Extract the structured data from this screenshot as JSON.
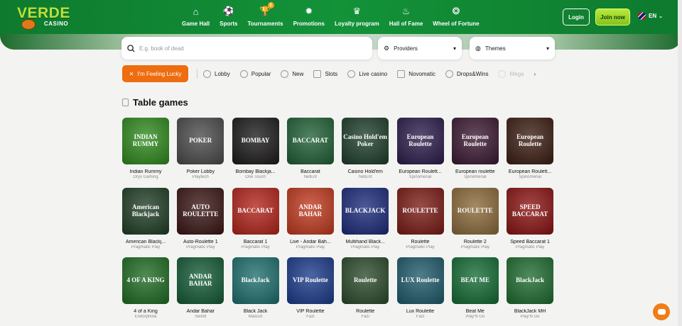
{
  "logo": {
    "big": "VERDE",
    "small": "CASINO"
  },
  "nav": [
    {
      "label": "Game Hall",
      "icon": "home-icon"
    },
    {
      "label": "Sports",
      "icon": "ball-icon"
    },
    {
      "label": "Tournaments",
      "icon": "trophy-icon",
      "badge": "2"
    },
    {
      "label": "Promotions",
      "icon": "gift-icon"
    },
    {
      "label": "Loyalty program",
      "icon": "crown-icon"
    },
    {
      "label": "Hall of Fame",
      "icon": "flame-icon"
    },
    {
      "label": "Wheel of Fortune",
      "icon": "wheel-icon"
    }
  ],
  "header": {
    "login": "Login",
    "join": "Join now",
    "lang": "EN"
  },
  "search": {
    "placeholder": "E.g. book of dead",
    "providers": "Providers",
    "themes": "Themes"
  },
  "filters": {
    "lucky": "I'm Feeling Lucky",
    "chips": [
      "Lobby",
      "Popular",
      "New",
      "Slots",
      "Live casino",
      "Novomatic",
      "Drops&Wins",
      "Mega"
    ]
  },
  "section": {
    "title": "Table games"
  },
  "colors": {
    "brand": "#139238",
    "accent": "#ed6d10",
    "join": "#9ad62a"
  },
  "games": [
    {
      "name": "Indian Rummy",
      "provider": "Oryx Gaming",
      "bg": "#2f8a1d",
      "art": "INDIAN RUMMY"
    },
    {
      "name": "Poker Lobby",
      "provider": "Playtech",
      "bg": "#4a4a4a",
      "art": "POKER"
    },
    {
      "name": "Bombay Blackja...",
      "provider": "One Touch",
      "bg": "#1c1a1a",
      "art": "BOMBAY"
    },
    {
      "name": "Baccarat",
      "provider": "NetEnt",
      "bg": "#1f5f34",
      "art": "BACCARAT"
    },
    {
      "name": "Casino Hold'em",
      "provider": "NetEnt",
      "bg": "#1c3d2a",
      "art": "Casino Hold'em Poker"
    },
    {
      "name": "European Roulett...",
      "provider": "Spinomenal",
      "bg": "#2b1b4a",
      "art": "European Roulette"
    },
    {
      "name": "European roulette",
      "provider": "Spinomenal",
      "bg": "#3a1830",
      "art": "European Roulette"
    },
    {
      "name": "European Roulett...",
      "provider": "Spinomenal",
      "bg": "#3b1c12",
      "art": "European Roulette"
    },
    {
      "name": "American Blackj...",
      "provider": "Pragmatic Play",
      "bg": "#1f3d25",
      "art": "American Blackjack"
    },
    {
      "name": "Auto-Roulette 1",
      "provider": "Pragmatic Play",
      "bg": "#3a1414",
      "art": "AUTO ROULETTE"
    },
    {
      "name": "Baccarat 1",
      "provider": "Pragmatic Play",
      "bg": "#b2231a",
      "art": "BACCARAT"
    },
    {
      "name": "Live - Andar Bah...",
      "provider": "Pragmatic Play",
      "bg": "#c0391e",
      "art": "ANDAR BAHAR"
    },
    {
      "name": "Multihand Black...",
      "provider": "Pragmatic Play",
      "bg": "#1b2a7a",
      "art": "BLACKJACK"
    },
    {
      "name": "Roulette",
      "provider": "Pragmatic Play",
      "bg": "#7a1a14",
      "art": "ROULETTE"
    },
    {
      "name": "Roulette 2",
      "provider": "Pragmatic Play",
      "bg": "#8b6a3a",
      "art": "ROULETTE"
    },
    {
      "name": "Speed Baccarat 1",
      "provider": "Pragmatic Play",
      "bg": "#8a1212",
      "art": "SPEED BACCARAT"
    },
    {
      "name": "4 of a King",
      "provider": "Endorphina",
      "bg": "#1f6b23",
      "art": "4 OF A KING"
    },
    {
      "name": "Andar Bahar",
      "provider": "Swintt",
      "bg": "#125a35",
      "art": "ANDAR BAHAR"
    },
    {
      "name": "Black Jack",
      "provider": "Mascot",
      "bg": "#1e6e6e",
      "art": "BlackJack"
    },
    {
      "name": "VIP Roulette",
      "provider": "Fazi",
      "bg": "#1a3a8a",
      "art": "VIP Roulette"
    },
    {
      "name": "Roulette",
      "provider": "Fazi",
      "bg": "#2a4a2a",
      "art": "Roulette"
    },
    {
      "name": "Lux Roulette",
      "provider": "Fazi",
      "bg": "#1d5a6a",
      "art": "LUX Roulette"
    },
    {
      "name": "Beat Me",
      "provider": "Play'N Go",
      "bg": "#146b33",
      "art": "BEAT ME"
    },
    {
      "name": "BlackJack MH",
      "provider": "Play'N Go",
      "bg": "#1d6b2e",
      "art": "BlackJack"
    }
  ]
}
